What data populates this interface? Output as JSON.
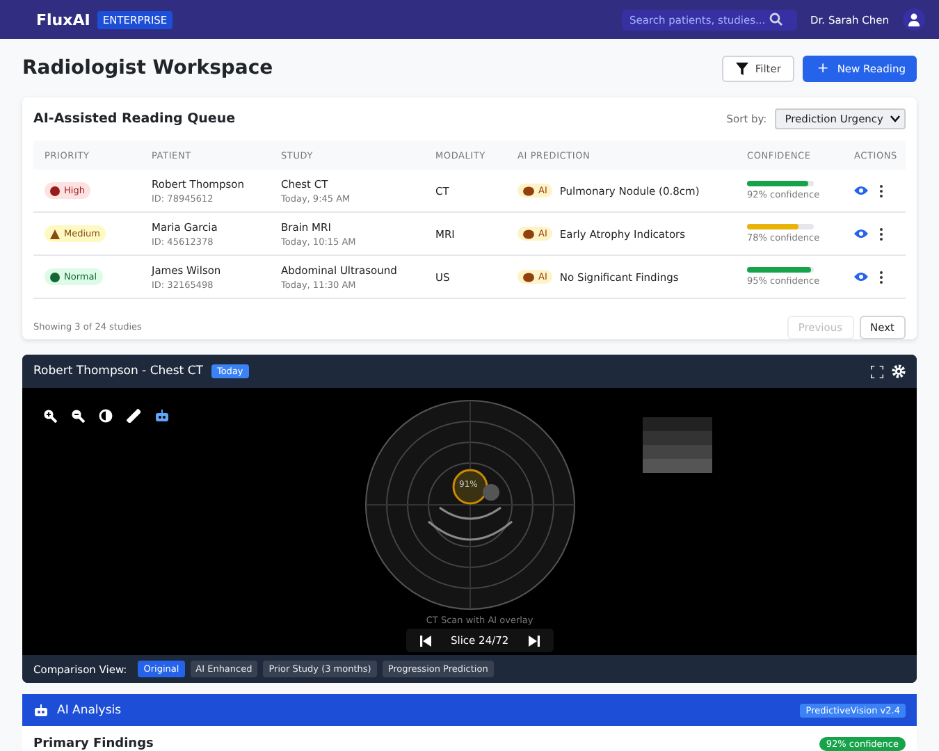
{
  "header": {
    "brand": "FluxAI",
    "edition": "ENTERPRISE",
    "search_placeholder": "Search patients, studies...",
    "user": "Dr. Sarah Chen"
  },
  "page": {
    "title": "Radiologist Workspace",
    "filter_button": "Filter",
    "new_button": "New Reading",
    "new_button_icon": "+"
  },
  "queue": {
    "title": "AI-Assisted Reading Queue",
    "sort_label": "Sort by:",
    "sort_value": "Prediction Urgency",
    "columns": [
      "PRIORITY",
      "PATIENT",
      "STUDY",
      "MODALITY",
      "AI PREDICTION",
      "CONFIDENCE",
      "ACTIONS"
    ],
    "rows": [
      {
        "priority": "High",
        "kind": "high",
        "patient": "Robert Thompson",
        "patient_id": "ID: 78945612",
        "study": "Chest CT",
        "time": "Today, 9:45 AM",
        "modality": "CT",
        "ai_tag": "AI",
        "prediction": "Pulmonary Nodule (0.8cm)",
        "level": 0.92,
        "color": "#16a34a",
        "confidence": "92% confidence"
      },
      {
        "priority": "Medium",
        "kind": "medium",
        "patient": "Maria Garcia",
        "patient_id": "ID: 45612378",
        "study": "Brain MRI",
        "time": "Today, 10:15 AM",
        "modality": "MRI",
        "ai_tag": "AI",
        "prediction": "Early Atrophy Indicators",
        "level": 0.78,
        "color": "#eab308",
        "confidence": "78% confidence"
      },
      {
        "priority": "Normal",
        "kind": "normal",
        "patient": "James Wilson",
        "patient_id": "ID: 32165498",
        "study": "Abdominal Ultrasound",
        "time": "Today, 11:30 AM",
        "modality": "US",
        "ai_tag": "AI",
        "prediction": "No Significant Findings",
        "level": 0.95,
        "color": "#16a34a",
        "confidence": "95% confidence"
      }
    ],
    "footer": "Showing 3 of 24 studies",
    "pages": [
      {
        "label": "Previous",
        "disabled": true
      },
      {
        "label": "Next",
        "disabled": false
      }
    ]
  },
  "viewer": {
    "title": "Robert Thompson - Chest CT",
    "badge": "Today",
    "overlay_label": "91%",
    "caption": "CT Scan with AI overlay",
    "slice": "Slice 24/72",
    "comparison_label": "Comparison View:",
    "views": [
      {
        "label": "Original",
        "selected": true
      },
      {
        "label": "AI Enhanced",
        "selected": false
      },
      {
        "label": "Prior Study (3 months)",
        "selected": false
      },
      {
        "label": "Progression Prediction",
        "selected": false
      }
    ]
  },
  "analysis": {
    "title": "AI Analysis",
    "version": "PredictiveVision v2.4",
    "section": "Primary Findings",
    "confidence": "92% confidence"
  }
}
